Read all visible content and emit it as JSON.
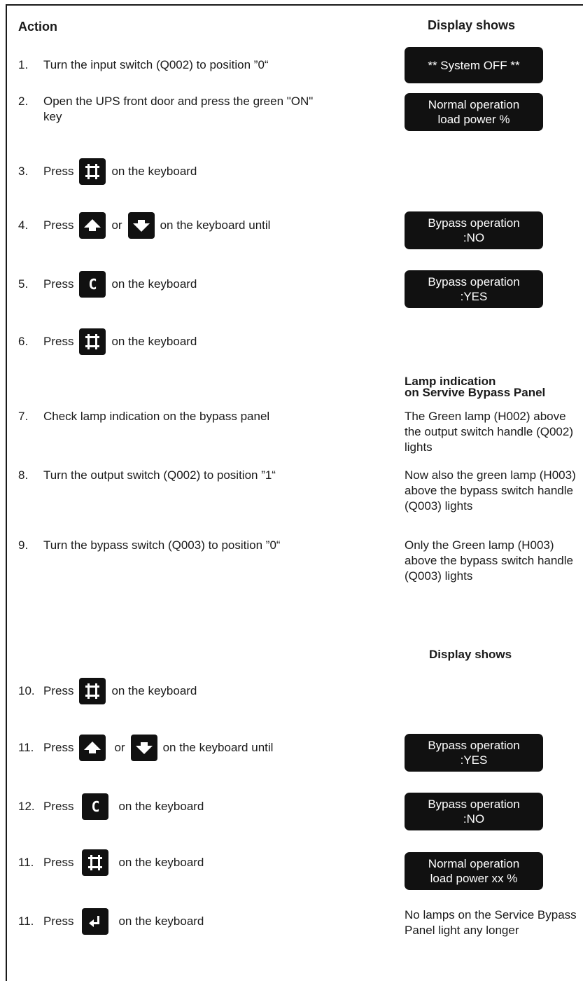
{
  "headers": {
    "action": "Action",
    "display_shows": "Display shows",
    "lamp_line1": "Lamp indication",
    "lamp_line2": "on Servive Bypass Panel",
    "display_shows_2": "Display shows"
  },
  "steps": [
    {
      "num": "1.",
      "text": "Turn the input switch (Q002) to position ”0“"
    },
    {
      "num": "2.",
      "text": "Open the UPS front door and press the green \"ON\" key"
    },
    {
      "num": "3.",
      "pre": "Press",
      "post": "on the keyboard"
    },
    {
      "num": "4.",
      "pre": "Press",
      "mid": "or",
      "post": "on the keyboard until"
    },
    {
      "num": "5.",
      "pre": "Press",
      "post": "on the keyboard"
    },
    {
      "num": "6.",
      "pre": "Press",
      "post": "on the keyboard"
    },
    {
      "num": "7.",
      "text": "Check lamp indication on the bypass panel"
    },
    {
      "num": "8.",
      "text": "Turn the output switch (Q002) to position ”1“"
    },
    {
      "num": "9.",
      "text": "Turn the bypass switch (Q003) to position ”0“"
    },
    {
      "num": "10.",
      "pre": "Press",
      "post": "on the keyboard"
    },
    {
      "num": "11.",
      "pre": "Press",
      "mid": "or",
      "post": "on the keyboard until"
    },
    {
      "num": "12.",
      "pre": "Press",
      "post": "on the keyboard"
    },
    {
      "num": "11.",
      "pre": "Press",
      "post": "on the keyboard"
    },
    {
      "num": "11.",
      "pre": "Press",
      "post": "on the keyboard"
    }
  ],
  "keys": {
    "c_label": "C"
  },
  "displays": [
    {
      "line1": "** System OFF **",
      "line2": ""
    },
    {
      "line1": "Normal operation",
      "line2": "load power %"
    },
    {
      "line1": "Bypass operation",
      "line2": ":NO"
    },
    {
      "line1": "Bypass operation",
      "line2": ":YES"
    },
    {
      "line1": "Bypass operation",
      "line2": ":YES"
    },
    {
      "line1": "Bypass operation",
      "line2": ":NO"
    },
    {
      "line1": "Normal operation",
      "line2": "load power xx %"
    }
  ],
  "lamp_notes": [
    "The Green lamp (H002) above the output switch handle (Q002) lights",
    "Now also the green lamp (H003) above the bypass switch handle (Q003) lights",
    "Only the Green lamp (H003) above the bypass switch handle (Q003) lights",
    "No lamps on the Service Bypass Panel light any longer"
  ],
  "colors": {
    "key_bg": "#111111",
    "display_bg": "#111111",
    "text": "#1a1a1a"
  }
}
